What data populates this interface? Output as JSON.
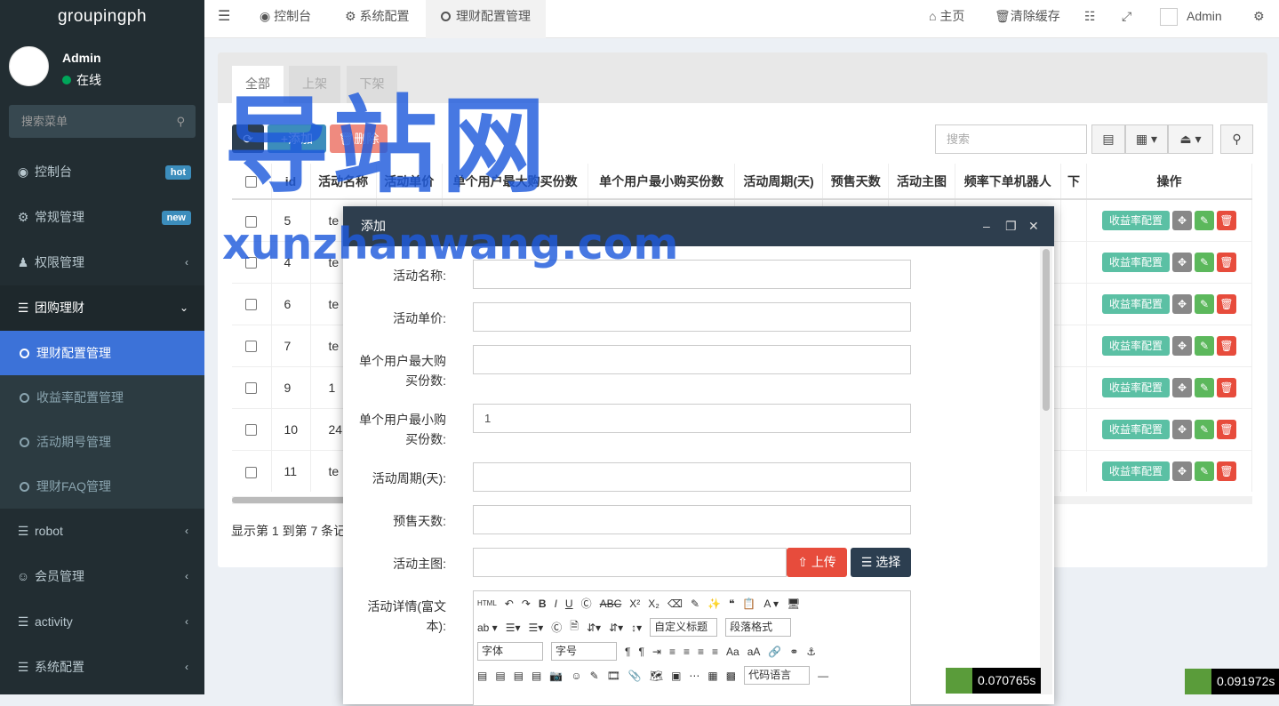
{
  "brand": "groupingph",
  "user": {
    "name": "Admin",
    "status": "在线"
  },
  "sidebar": {
    "search_placeholder": "搜索菜单",
    "items": [
      {
        "label": "控制台",
        "badge": "hot",
        "badge_color": "#3c8dbc"
      },
      {
        "label": "常规管理",
        "badge": "new",
        "badge_color": "#3c8dbc"
      },
      {
        "label": "权限管理"
      },
      {
        "label": "团购理财"
      },
      {
        "label": "robot"
      },
      {
        "label": "会员管理"
      },
      {
        "label": "activity"
      },
      {
        "label": "系统配置"
      }
    ],
    "sub_items": [
      {
        "label": "理财配置管理"
      },
      {
        "label": "收益率配置管理"
      },
      {
        "label": "活动期号管理"
      },
      {
        "label": "理财FAQ管理"
      }
    ]
  },
  "topbar": {
    "tabs": [
      "控制台",
      "系统配置",
      "理财配置管理"
    ],
    "right": {
      "home": "主页",
      "clear_cache": "清除缓存",
      "user": "Admin"
    }
  },
  "page_tabs": [
    "全部",
    "上架",
    "下架"
  ],
  "toolbar": {
    "add": "添加",
    "delete": "删除",
    "search_placeholder": "搜索"
  },
  "table": {
    "headers": [
      "id",
      "活动名称",
      "活动单价",
      "单个用户最大购买份数",
      "单个用户最小购买份数",
      "活动周期(天)",
      "预售天数",
      "活动主图",
      "频率下单机器人",
      "下",
      "操作"
    ],
    "rows": [
      {
        "id": "5",
        "name": "te"
      },
      {
        "id": "4",
        "name": "te"
      },
      {
        "id": "6",
        "name": "te"
      },
      {
        "id": "7",
        "name": "te"
      },
      {
        "id": "9",
        "name": "1"
      },
      {
        "id": "10",
        "name": "24"
      },
      {
        "id": "11",
        "name": "te"
      }
    ],
    "op_label": "收益率配置"
  },
  "footer": "显示第 1 到第 7 条记",
  "modal": {
    "title": "添加",
    "fields": [
      {
        "label": "活动名称:",
        "value": ""
      },
      {
        "label": "活动单价:",
        "value": ""
      },
      {
        "label": "单个用户最大购买份数:",
        "value": ""
      },
      {
        "label": "单个用户最小购买份数:",
        "value": "1"
      },
      {
        "label": "活动周期(天):",
        "value": ""
      },
      {
        "label": "预售天数:",
        "value": ""
      },
      {
        "label": "活动主图:",
        "value": ""
      },
      {
        "label": "活动详情(富文本):",
        "value": ""
      }
    ],
    "upload": "上传",
    "choose": "选择",
    "editor": {
      "custom_title": "自定义标题",
      "paragraph": "段落格式",
      "font": "字体",
      "size": "字号",
      "code_lang": "代码语言"
    }
  },
  "perf": [
    "0.070765s",
    "0.091972s"
  ],
  "watermark": {
    "big": "导站网",
    "url": "xunzhanwang.com"
  },
  "colors": {
    "sidebar": "#222d32",
    "active": "#3c72d8",
    "success": "#5cb85c",
    "danger": "#e74c3c",
    "primary": "#3c8dbc",
    "teal": "#5bc0a4"
  }
}
